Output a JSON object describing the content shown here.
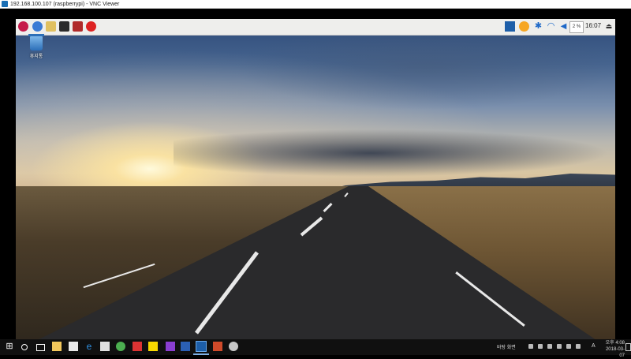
{
  "window": {
    "title": "192.168.100.107 (raspberrypi) - VNC Viewer"
  },
  "pi_panel": {
    "cpu_label": "2 %",
    "clock": "16:07",
    "icons": [
      "raspberry-menu-icon",
      "browser-icon",
      "file-manager-icon",
      "terminal-icon",
      "math-icon",
      "wolfram-icon",
      "vnc-icon",
      "ime-icon",
      "bluetooth-icon",
      "wifi-icon",
      "volume-icon",
      "eject-icon"
    ]
  },
  "desktop": {
    "trash_label": "휴지통"
  },
  "taskbar": {
    "tray_text": "바탕 화면",
    "ime": "A",
    "time": "오후 4:08",
    "date": "2018-03-07"
  }
}
